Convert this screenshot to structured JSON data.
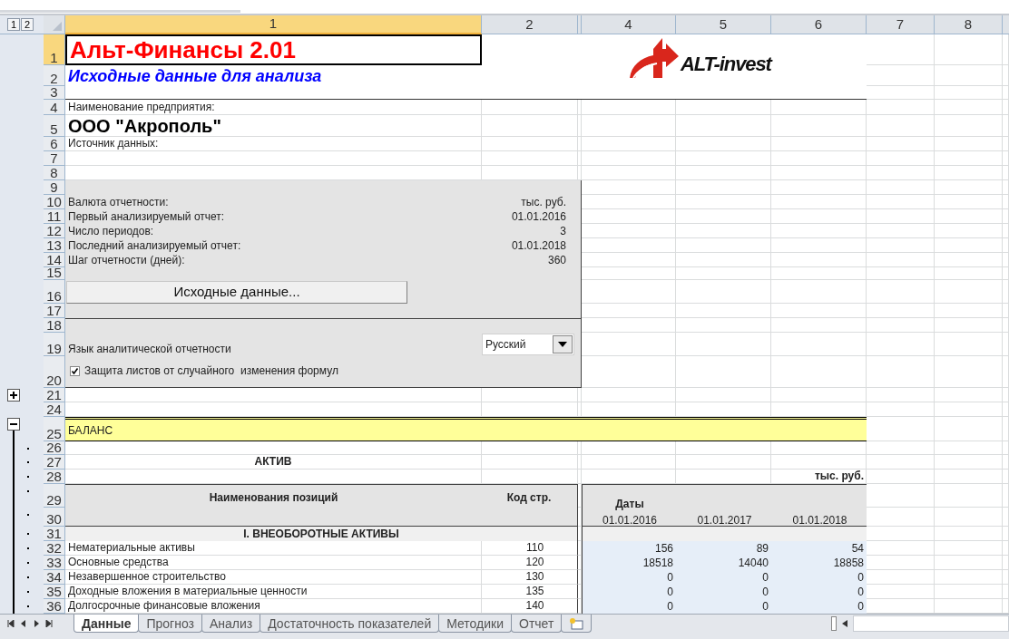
{
  "outline_levels": [
    "1",
    "2"
  ],
  "columns": [
    {
      "label": "1",
      "selected": true
    },
    {
      "label": "2",
      "selected": false
    },
    {
      "label": "4",
      "selected": false
    },
    {
      "label": "5",
      "selected": false
    },
    {
      "label": "6",
      "selected": false
    },
    {
      "label": "7",
      "selected": false
    },
    {
      "label": "8",
      "selected": false
    }
  ],
  "logo": {
    "text": "ALT-invest"
  },
  "rows": [
    {
      "number": "1",
      "selected": true,
      "kind": "title",
      "text": "Альт-Финансы 2.01"
    },
    {
      "number": "2",
      "selected": false,
      "kind": "subtitle",
      "text": "Исходные данные для анализа"
    },
    {
      "number": "3",
      "selected": false,
      "kind": "rule"
    },
    {
      "number": "4",
      "selected": false,
      "kind": "label",
      "text": "Наименование предприятия:"
    },
    {
      "number": "5",
      "selected": false,
      "kind": "company",
      "text": "ООО \"Акрополь\""
    },
    {
      "number": "6",
      "selected": false,
      "kind": "label",
      "text": "Источник данных:"
    },
    {
      "number": "7",
      "selected": false,
      "kind": "blank"
    },
    {
      "number": "8",
      "selected": false,
      "kind": "blank"
    },
    {
      "number": "9",
      "selected": false,
      "kind": "panel_space"
    },
    {
      "number": "10",
      "selected": false,
      "kind": "field",
      "label": "Валюта отчетности:",
      "value": "тыс. руб."
    },
    {
      "number": "11",
      "selected": false,
      "kind": "field",
      "label": "Первый анализируемый отчет:",
      "value": "01.01.2016"
    },
    {
      "number": "12",
      "selected": false,
      "kind": "field",
      "label": "Число периодов:",
      "value": "3"
    },
    {
      "number": "13",
      "selected": false,
      "kind": "field",
      "label": "Последний анализируемый отчет:",
      "value": "01.01.2018"
    },
    {
      "number": "14",
      "selected": false,
      "kind": "field",
      "label": "Шаг отчетности (дней):",
      "value": "360"
    },
    {
      "number": "15",
      "selected": false,
      "kind": "panel_space"
    },
    {
      "number": "16",
      "selected": false,
      "kind": "button",
      "text": "Исходные данные..."
    },
    {
      "number": "17",
      "selected": false,
      "kind": "panel_space"
    },
    {
      "number": "18",
      "selected": false,
      "kind": "panel_divider"
    },
    {
      "number": "19",
      "selected": false,
      "kind": "select",
      "label": "Язык аналитической отчетности",
      "value": "Русский"
    },
    {
      "number": "20",
      "selected": false,
      "kind": "checkbox",
      "label": "Защита листов от случайного  изменения формул",
      "checked": true
    },
    {
      "number": "21",
      "selected": false,
      "kind": "blank",
      "outline": {
        "kind": "expand"
      }
    },
    {
      "number": "24",
      "selected": false,
      "kind": "blank"
    },
    {
      "number": "25",
      "selected": false,
      "kind": "section",
      "text": "БАЛАНС",
      "outline": {
        "kind": "collapse"
      }
    },
    {
      "number": "26",
      "selected": false,
      "kind": "blank",
      "outline": {
        "kind": "detail"
      }
    },
    {
      "number": "27",
      "selected": false,
      "kind": "heading",
      "text": "АКТИВ",
      "outline": {
        "kind": "detail"
      }
    },
    {
      "number": "28",
      "selected": false,
      "kind": "units",
      "units": "тыс. руб.",
      "outline": {
        "kind": "detail"
      }
    },
    {
      "number": "29",
      "selected": false,
      "kind": "table_head",
      "name_header": "Наименования позиций",
      "code_header": "Код стр.",
      "dates_header": "Даты",
      "outline": {
        "kind": "detail"
      }
    },
    {
      "number": "30",
      "selected": false,
      "kind": "dates",
      "dates": [
        "01.01.2016",
        "01.01.2017",
        "01.01.2018"
      ],
      "outline": {
        "kind": "detail"
      }
    },
    {
      "number": "31",
      "selected": false,
      "kind": "group",
      "text": "I. ВНЕОБОРОТНЫЕ АКТИВЫ",
      "outline": {
        "kind": "detail"
      }
    },
    {
      "number": "32",
      "selected": false,
      "kind": "data",
      "name": "Нематериальные активы",
      "code": "110",
      "values": [
        "156",
        "89",
        "54"
      ],
      "outline": {
        "kind": "detail"
      }
    },
    {
      "number": "33",
      "selected": false,
      "kind": "data",
      "name": "Основные средства",
      "code": "120",
      "values": [
        "18518",
        "14040",
        "18858"
      ],
      "outline": {
        "kind": "detail"
      }
    },
    {
      "number": "34",
      "selected": false,
      "kind": "data",
      "name": "Незавершенное строительство",
      "code": "130",
      "values": [
        "0",
        "0",
        "0"
      ],
      "outline": {
        "kind": "detail"
      }
    },
    {
      "number": "35",
      "selected": false,
      "kind": "data",
      "name": "Доходные вложения в материальные ценности",
      "code": "135",
      "values": [
        "0",
        "0",
        "0"
      ],
      "outline": {
        "kind": "detail"
      }
    },
    {
      "number": "36",
      "selected": false,
      "kind": "data",
      "name": "Долгосрочные финансовые  вложения",
      "code": "140",
      "values": [
        "0",
        "0",
        "0"
      ],
      "outline": {
        "kind": "detail"
      }
    }
  ],
  "sheet_tabs": [
    {
      "label": "Данные",
      "selected": true
    },
    {
      "label": "Прогноз",
      "selected": false
    },
    {
      "label": "Анализ",
      "selected": false
    },
    {
      "label": "Достаточность показателей",
      "selected": false
    },
    {
      "label": "Методики",
      "selected": false
    },
    {
      "label": "Отчет",
      "selected": false
    }
  ]
}
